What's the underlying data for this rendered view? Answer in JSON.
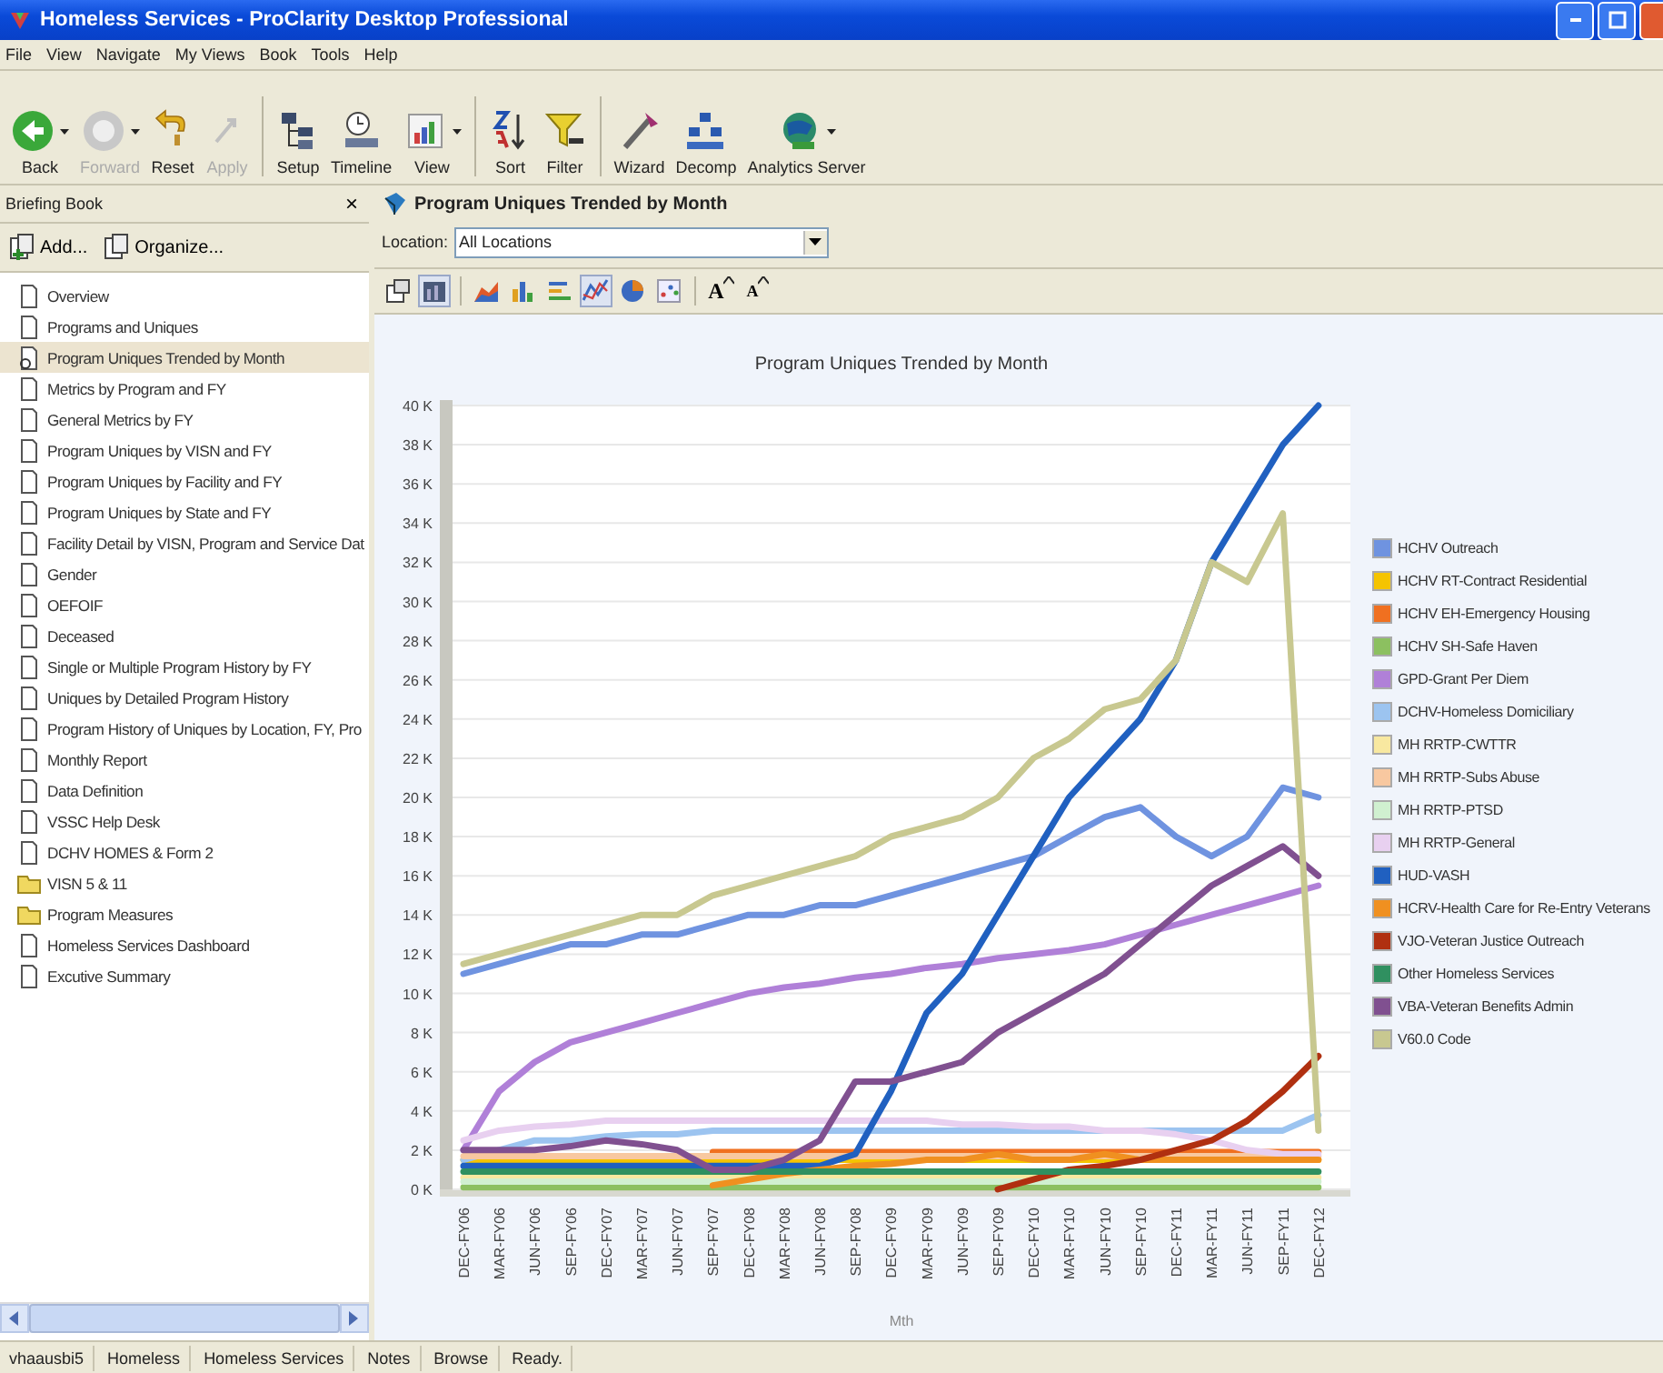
{
  "window": {
    "title": "Homeless Services - ProClarity Desktop Professional"
  },
  "menu": [
    "File",
    "View",
    "Navigate",
    "My Views",
    "Book",
    "Tools",
    "Help"
  ],
  "toolbar": [
    {
      "buttons": [
        {
          "label": "Back",
          "kind": "back",
          "disabled": false,
          "dropdown": true
        },
        {
          "label": "Forward",
          "kind": "forward",
          "disabled": true,
          "dropdown": true
        },
        {
          "label": "Reset",
          "kind": "reset",
          "disabled": false,
          "dropdown": false
        },
        {
          "label": "Apply",
          "kind": "apply",
          "disabled": true,
          "dropdown": false
        }
      ]
    },
    {
      "buttons": [
        {
          "label": "Setup",
          "kind": "setup",
          "disabled": false,
          "dropdown": false
        },
        {
          "label": "Timeline",
          "kind": "timeline",
          "disabled": false,
          "dropdown": false
        },
        {
          "label": "View",
          "kind": "view",
          "disabled": false,
          "dropdown": true
        }
      ]
    },
    {
      "buttons": [
        {
          "label": "Sort",
          "kind": "sort",
          "disabled": false,
          "dropdown": false
        },
        {
          "label": "Filter",
          "kind": "filter",
          "disabled": false,
          "dropdown": false
        }
      ]
    },
    {
      "buttons": [
        {
          "label": "Wizard",
          "kind": "wizard",
          "disabled": false,
          "dropdown": false
        },
        {
          "label": "Decomp",
          "kind": "decomp",
          "disabled": false,
          "dropdown": false
        },
        {
          "label": "Analytics Server",
          "kind": "analytics",
          "disabled": false,
          "dropdown": true
        }
      ]
    }
  ],
  "briefing_book": {
    "title": "Briefing Book",
    "close": "×",
    "actions": [
      {
        "label": "Add...",
        "kind": "add"
      },
      {
        "label": "Organize...",
        "kind": "organize"
      }
    ],
    "items": [
      {
        "label": "Overview",
        "kind": "document",
        "selected": false
      },
      {
        "label": "Programs and Uniques",
        "kind": "document",
        "selected": false
      },
      {
        "label": "Program Uniques Trended by Month",
        "kind": "document",
        "selected": true
      },
      {
        "label": "Metrics by Program and FY",
        "kind": "document",
        "selected": false
      },
      {
        "label": "General Metrics by FY",
        "kind": "document",
        "selected": false
      },
      {
        "label": "Program Uniques by VISN and FY",
        "kind": "document",
        "selected": false
      },
      {
        "label": "Program Uniques by Facility and FY",
        "kind": "document",
        "selected": false
      },
      {
        "label": "Program Uniques by State and FY",
        "kind": "document",
        "selected": false
      },
      {
        "label": "Facility Detail by VISN, Program and Service Dat",
        "kind": "document",
        "selected": false
      },
      {
        "label": "Gender",
        "kind": "document",
        "selected": false
      },
      {
        "label": "OEFOIF",
        "kind": "document",
        "selected": false
      },
      {
        "label": "Deceased",
        "kind": "document",
        "selected": false
      },
      {
        "label": "Single or Multiple Program History by FY",
        "kind": "document",
        "selected": false
      },
      {
        "label": "Uniques by Detailed Program History",
        "kind": "document",
        "selected": false
      },
      {
        "label": "Program History of Uniques by Location, FY, Pro",
        "kind": "document",
        "selected": false
      },
      {
        "label": "Monthly Report",
        "kind": "document",
        "selected": false
      },
      {
        "label": "Data Definition",
        "kind": "document",
        "selected": false
      },
      {
        "label": "VSSC Help Desk",
        "kind": "document",
        "selected": false
      },
      {
        "label": "DCHV HOMES & Form 2",
        "kind": "document",
        "selected": false
      },
      {
        "label": "VISN 5 & 11",
        "kind": "folder",
        "selected": false
      },
      {
        "label": "Program Measures",
        "kind": "folder",
        "selected": false
      },
      {
        "label": "Homeless Services Dashboard",
        "kind": "document",
        "selected": false
      },
      {
        "label": "Excutive Summary",
        "kind": "document",
        "selected": false
      }
    ]
  },
  "report": {
    "title": "Program Uniques Trended by Month",
    "location_label": "Location:",
    "location_value": "All Locations",
    "chart_toolbar": [
      {
        "kind": "properties",
        "selected": false
      },
      {
        "kind": "bookmark",
        "selected": true
      },
      {
        "kind": "area",
        "selected": false
      },
      {
        "kind": "bar",
        "selected": false
      },
      {
        "kind": "hbar",
        "selected": false
      },
      {
        "kind": "line",
        "selected": true
      },
      {
        "kind": "pie",
        "selected": false
      },
      {
        "kind": "scatter",
        "selected": false
      },
      {
        "kind": "font-up",
        "selected": false,
        "label": "A"
      },
      {
        "kind": "font-down",
        "selected": false,
        "label": "A"
      }
    ],
    "chart": {
      "chart_data": {
        "type": "line",
        "title": "Program Uniques Trended by Month",
        "xlabel": "Mth",
        "categories": [
          "DEC-FY06",
          "MAR-FY06",
          "JUN-FY06",
          "SEP-FY06",
          "DEC-FY07",
          "MAR-FY07",
          "JUN-FY07",
          "SEP-FY07",
          "DEC-FY08",
          "MAR-FY08",
          "JUN-FY08",
          "SEP-FY08",
          "DEC-FY09",
          "MAR-FY09",
          "JUN-FY09",
          "SEP-FY09",
          "DEC-FY10",
          "MAR-FY10",
          "JUN-FY10",
          "SEP-FY10",
          "DEC-FY11",
          "MAR-FY11",
          "JUN-FY11",
          "SEP-FY11",
          "DEC-FY12"
        ],
        "ylim": [
          0,
          40000
        ],
        "grid": true,
        "legend": true,
        "yticks": [
          {
            "value": 0,
            "label": "0 K"
          },
          {
            "value": 2000,
            "label": "2 K"
          },
          {
            "value": 4000,
            "label": "4 K"
          },
          {
            "value": 6000,
            "label": "6 K"
          },
          {
            "value": 8000,
            "label": "8 K"
          },
          {
            "value": 10000,
            "label": "10 K"
          },
          {
            "value": 12000,
            "label": "12 K"
          },
          {
            "value": 14000,
            "label": "14 K"
          },
          {
            "value": 16000,
            "label": "16 K"
          },
          {
            "value": 18000,
            "label": "18 K"
          },
          {
            "value": 20000,
            "label": "20 K"
          },
          {
            "value": 22000,
            "label": "22 K"
          },
          {
            "value": 24000,
            "label": "24 K"
          },
          {
            "value": 26000,
            "label": "26 K"
          },
          {
            "value": 28000,
            "label": "28 K"
          },
          {
            "value": 30000,
            "label": "30 K"
          },
          {
            "value": 32000,
            "label": "32 K"
          },
          {
            "value": 34000,
            "label": "34 K"
          },
          {
            "value": 36000,
            "label": "36 K"
          },
          {
            "value": 38000,
            "label": "38 K"
          },
          {
            "value": 40000,
            "label": "40 K"
          }
        ],
        "series": [
          {
            "name": "HCHV Outreach",
            "color": "#6f93e0",
            "values": [
              11000,
              11500,
              12000,
              12500,
              12500,
              13000,
              13000,
              13500,
              14000,
              14000,
              14500,
              14500,
              15000,
              15500,
              16000,
              16500,
              17000,
              18000,
              19000,
              19500,
              18000,
              17000,
              18000,
              20500,
              20000
            ]
          },
          {
            "name": "HCHV RT-Contract Residential",
            "color": "#f5c400",
            "values": [
              1500,
              1500,
              1500,
              1500,
              1500,
              1500,
              1500,
              1500,
              1500,
              1500,
              1500,
              1500,
              1500,
              1500,
              1500,
              1500,
              1500,
              1500,
              1500,
              1500,
              1500,
              1500,
              1500,
              1500,
              1500
            ]
          },
          {
            "name": "HCHV EH-Emergency Housing",
            "color": "#f07020",
            "values": [
              null,
              null,
              null,
              null,
              null,
              null,
              null,
              1900,
              1900,
              1900,
              1900,
              1900,
              1900,
              1900,
              1900,
              1900,
              1900,
              1900,
              1900,
              1900,
              1900,
              1900,
              1900,
              1900,
              1900
            ]
          },
          {
            "name": "HCHV SH-Safe Haven",
            "color": "#8cc060",
            "values": [
              100,
              100,
              100,
              100,
              100,
              100,
              100,
              100,
              100,
              100,
              100,
              100,
              100,
              100,
              100,
              100,
              100,
              100,
              100,
              100,
              100,
              100,
              100,
              100,
              100
            ]
          },
          {
            "name": "GPD-Grant Per Diem",
            "color": "#b080d8",
            "values": [
              2000,
              5000,
              6500,
              7500,
              8000,
              8500,
              9000,
              9500,
              10000,
              10300,
              10500,
              10800,
              11000,
              11300,
              11500,
              11800,
              12000,
              12200,
              12500,
              13000,
              13500,
              14000,
              14500,
              15000,
              15500
            ]
          },
          {
            "name": "DCHV-Homeless Domiciliary",
            "color": "#9cc4f0",
            "values": [
              1500,
              2000,
              2500,
              2500,
              2700,
              2800,
              2800,
              3000,
              3000,
              3000,
              3000,
              3000,
              3000,
              3000,
              3000,
              3000,
              3000,
              3000,
              3000,
              3000,
              3000,
              3000,
              3000,
              3000,
              3800
            ]
          },
          {
            "name": "MH RRTP-CWTTR",
            "color": "#f8e8a0",
            "values": [
              600,
              600,
              600,
              600,
              600,
              600,
              600,
              600,
              600,
              600,
              600,
              600,
              600,
              600,
              600,
              600,
              600,
              600,
              600,
              600,
              600,
              600,
              600,
              600,
              600
            ]
          },
          {
            "name": "MH RRTP-Subs Abuse",
            "color": "#f8c8a0",
            "values": [
              1700,
              1700,
              1700,
              1700,
              1700,
              1700,
              1700,
              1700,
              1700,
              1700,
              1700,
              1700,
              1700,
              1700,
              1700,
              1700,
              1700,
              1700,
              1700,
              1700,
              1700,
              1700,
              1700,
              1700,
              1700
            ]
          },
          {
            "name": "MH RRTP-PTSD",
            "color": "#d0f0d0",
            "values": [
              400,
              400,
              400,
              400,
              400,
              400,
              400,
              400,
              400,
              400,
              400,
              400,
              400,
              400,
              400,
              400,
              400,
              400,
              400,
              400,
              400,
              400,
              400,
              400,
              400
            ]
          },
          {
            "name": "MH RRTP-General",
            "color": "#e8d0f0",
            "values": [
              2500,
              3000,
              3200,
              3300,
              3500,
              3500,
              3500,
              3500,
              3500,
              3500,
              3500,
              3500,
              3500,
              3500,
              3300,
              3300,
              3200,
              3200,
              3000,
              3000,
              2800,
              2500,
              2000,
              1800,
              1800
            ]
          },
          {
            "name": "HUD-VASH",
            "color": "#2060c0",
            "values": [
              1200,
              1200,
              1200,
              1200,
              1200,
              1200,
              1200,
              1200,
              1200,
              1200,
              1200,
              1800,
              5000,
              9000,
              11000,
              14000,
              17000,
              20000,
              22000,
              24000,
              27000,
              32000,
              35000,
              38000,
              40000
            ]
          },
          {
            "name": "HCRV-Health Care for Re-Entry Veterans",
            "color": "#f09020",
            "values": [
              null,
              null,
              null,
              null,
              null,
              null,
              null,
              200,
              500,
              800,
              1000,
              1200,
              1300,
              1500,
              1500,
              1800,
              1500,
              1500,
              1800,
              1500,
              1500,
              1500,
              1500,
              1500,
              1500
            ]
          },
          {
            "name": "VJO-Veteran Justice Outreach",
            "color": "#b03010",
            "values": [
              null,
              null,
              null,
              null,
              null,
              null,
              null,
              null,
              null,
              null,
              null,
              null,
              null,
              null,
              null,
              0,
              500,
              1000,
              1200,
              1500,
              2000,
              2500,
              3500,
              5000,
              6800
            ]
          },
          {
            "name": "Other Homeless Services",
            "color": "#309060",
            "values": [
              900,
              900,
              900,
              900,
              900,
              900,
              900,
              900,
              900,
              900,
              900,
              900,
              900,
              900,
              900,
              900,
              900,
              900,
              900,
              900,
              900,
              900,
              900,
              900,
              900
            ]
          },
          {
            "name": "VBA-Veteran Benefits Admin",
            "color": "#805090",
            "values": [
              2000,
              2000,
              2000,
              2200,
              2500,
              2300,
              2000,
              1000,
              1000,
              1500,
              2500,
              5500,
              5500,
              6000,
              6500,
              8000,
              9000,
              10000,
              11000,
              12500,
              14000,
              15500,
              16500,
              17500,
              16000
            ]
          },
          {
            "name": "V60.0 Code",
            "color": "#c8c890",
            "values": [
              11500,
              12000,
              12500,
              13000,
              13500,
              14000,
              14000,
              15000,
              15500,
              16000,
              16500,
              17000,
              18000,
              18500,
              19000,
              20000,
              22000,
              23000,
              24500,
              25000,
              27000,
              32000,
              31000,
              34500,
              3000
            ]
          }
        ]
      }
    }
  },
  "status_bar": [
    "vhaausbi5",
    "Homeless",
    "Homeless Services",
    "Notes",
    "Browse",
    "Ready."
  ]
}
